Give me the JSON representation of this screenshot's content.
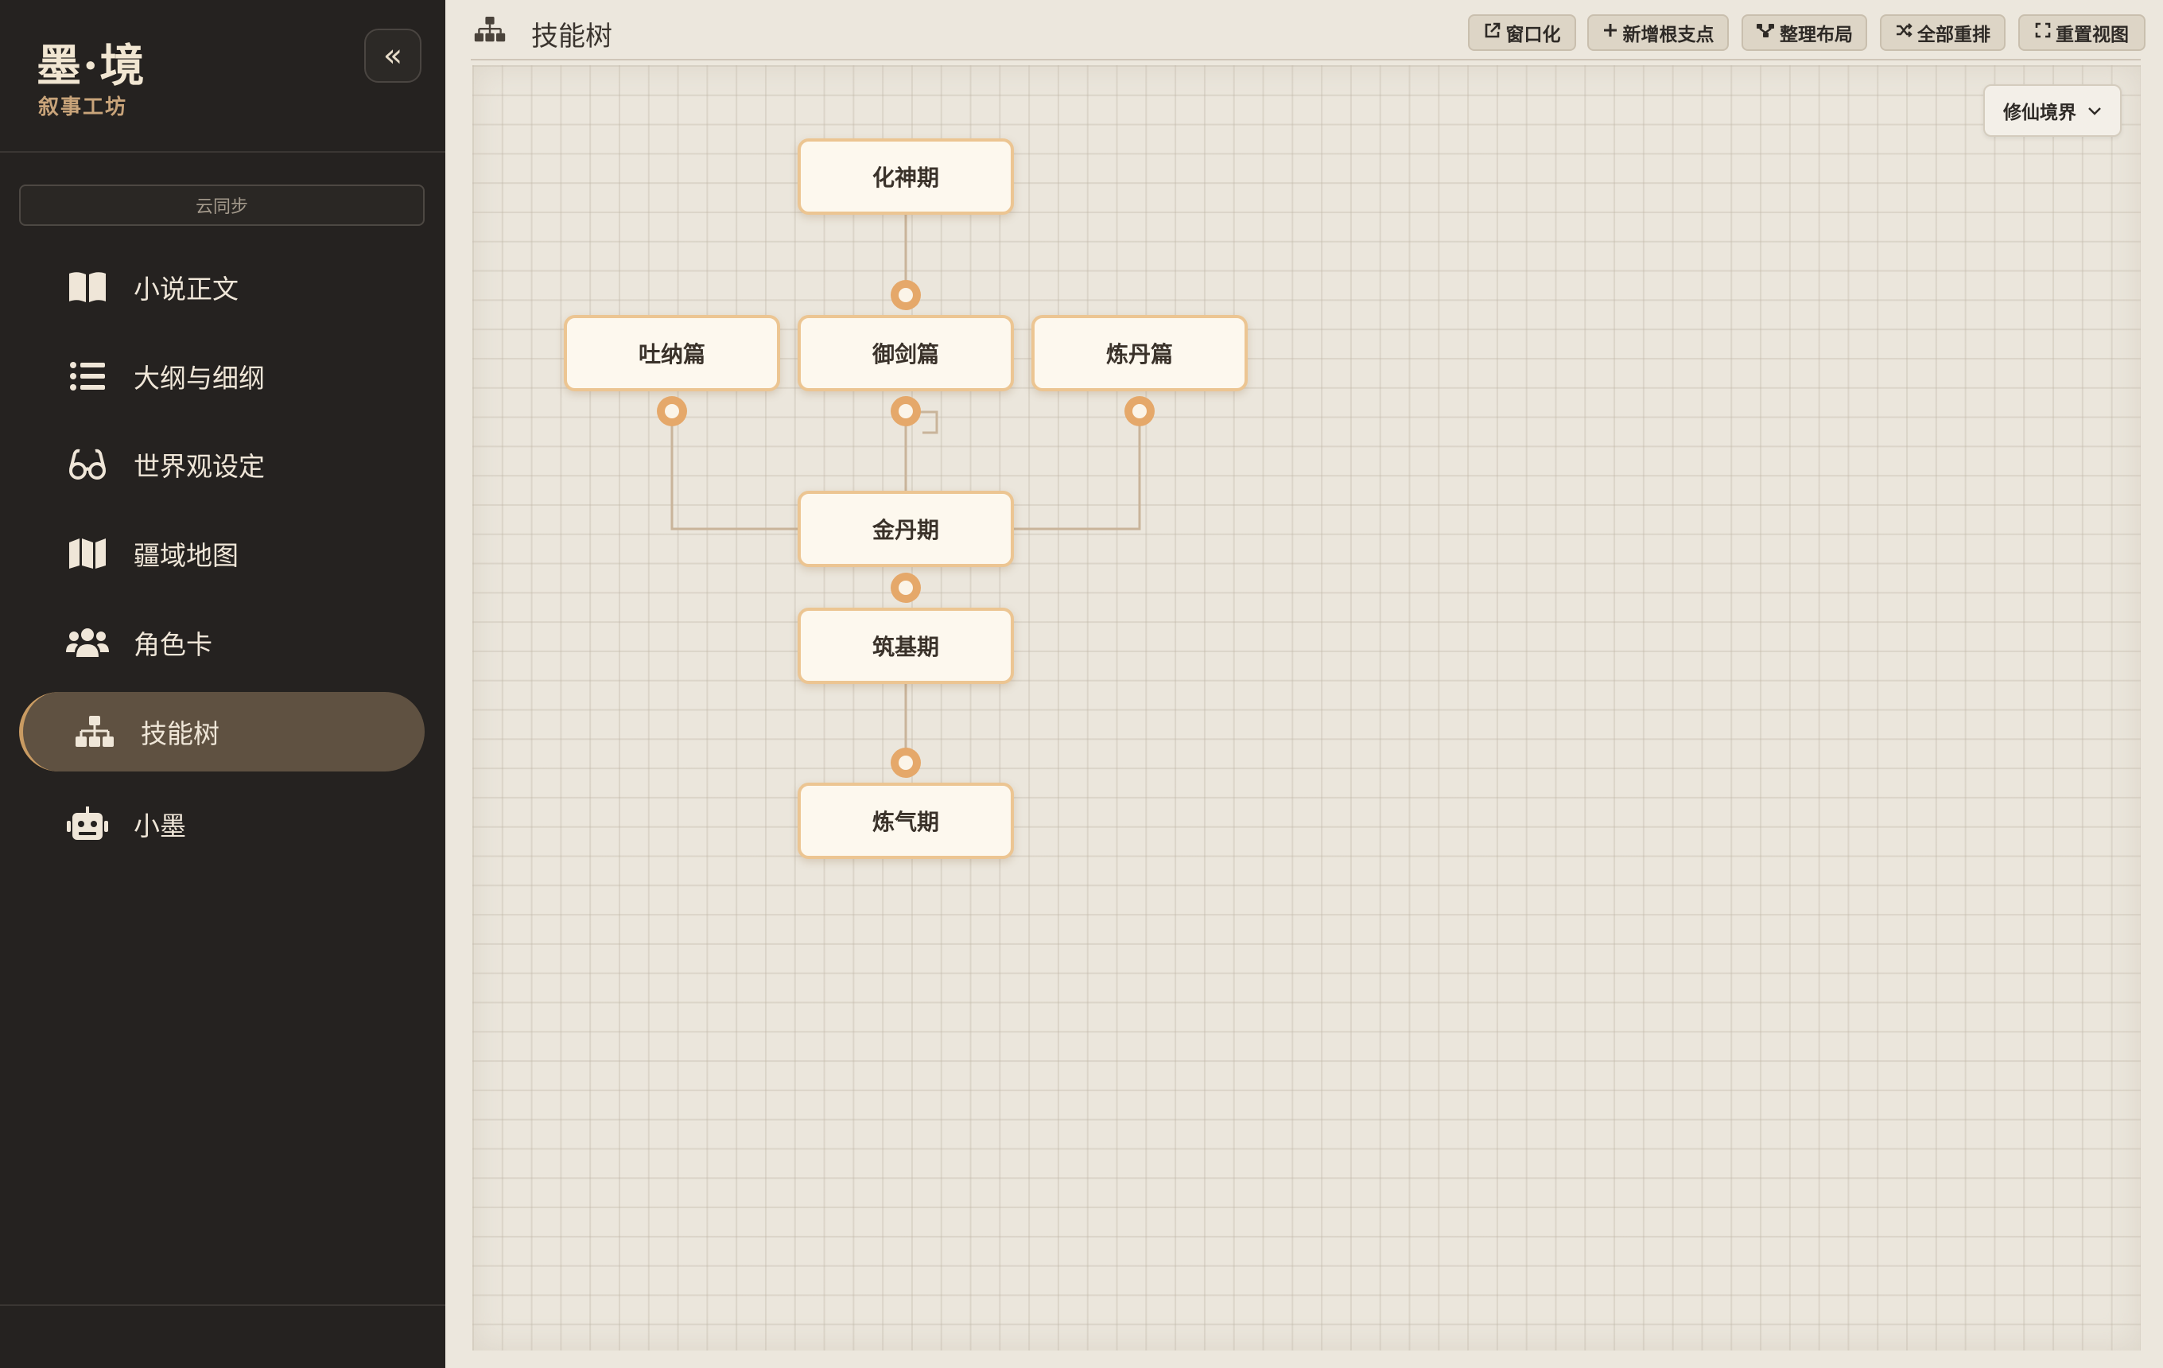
{
  "sidebar": {
    "brand_title": "墨·境",
    "brand_subtitle": "叙事工坊",
    "collapse_icon": "«",
    "sync_label": "云同步",
    "items": [
      {
        "label": "小说正文",
        "icon": "book-open-icon"
      },
      {
        "label": "大纲与细纲",
        "icon": "list-icon"
      },
      {
        "label": "世界观设定",
        "icon": "glasses-icon"
      },
      {
        "label": "疆域地图",
        "icon": "map-icon"
      },
      {
        "label": "角色卡",
        "icon": "users-icon"
      },
      {
        "label": "技能树",
        "icon": "sitemap-icon",
        "active": true
      },
      {
        "label": "小墨",
        "icon": "robot-icon"
      }
    ]
  },
  "header": {
    "title": "技能树",
    "icon": "sitemap-icon",
    "buttons": [
      {
        "label": "窗口化",
        "icon": "external-link-icon"
      },
      {
        "label": "新增根支点",
        "icon": "plus-icon"
      },
      {
        "label": "整理布局",
        "icon": "branch-icon"
      },
      {
        "label": "全部重排",
        "icon": "shuffle-icon"
      },
      {
        "label": "重置视图",
        "icon": "expand-icon"
      }
    ]
  },
  "canvas": {
    "tree_select": "修仙境界",
    "nodes": {
      "huashen": "化神期",
      "tuna": "吐纳篇",
      "yujian": "御剑篇",
      "liandan": "炼丹篇",
      "jindan": "金丹期",
      "zhuji": "筑基期",
      "lianqi": "炼气期"
    }
  },
  "colors": {
    "sidebar_bg": "#252220",
    "active_item_bg": "#5f5141",
    "accent": "#c99b62",
    "node_border": "#ecc592",
    "handle": "#e5a86a",
    "edge": "#c9b49a"
  }
}
